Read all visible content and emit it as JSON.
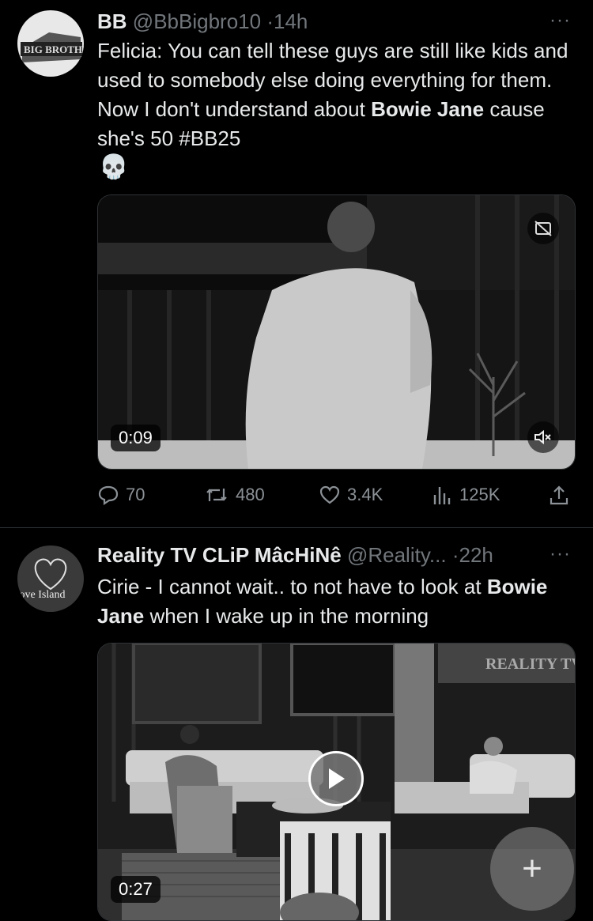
{
  "tweets": [
    {
      "display_name": "BB",
      "handle": "@BbBigbro10",
      "time": "14h",
      "more": "···",
      "avatar_text": "BIG BROTHER",
      "text_parts": [
        "Felicia: You can tell these guys are still like kids and used to somebody else doing everything for them. Now I don't understand about ",
        "Bowie Jane",
        " cause she's 50 ",
        "#BB25"
      ],
      "emoji": "💀",
      "video_time": "0:09",
      "replies": "70",
      "reposts": "480",
      "likes": "3.4K",
      "views": "125K"
    },
    {
      "display_name": "Reality TV CLiP MâcHiNê",
      "handle": "@Reality...",
      "time": "22h",
      "more": "···",
      "avatar_text": "Love Island",
      "text_parts": [
        "Cirie - I cannot wait.. to not have to look at ",
        "Bowie Jane",
        " when I wake up in the morning"
      ],
      "video_time": "0:27",
      "watermark": "REALITY TV"
    }
  ],
  "compose_label": "+",
  "icons": [
    "reply-icon",
    "repost-icon",
    "like-icon",
    "views-icon",
    "share-icon",
    "captions-icon",
    "mute-icon",
    "play-icon",
    "skull-emoji",
    "compose-icon"
  ]
}
